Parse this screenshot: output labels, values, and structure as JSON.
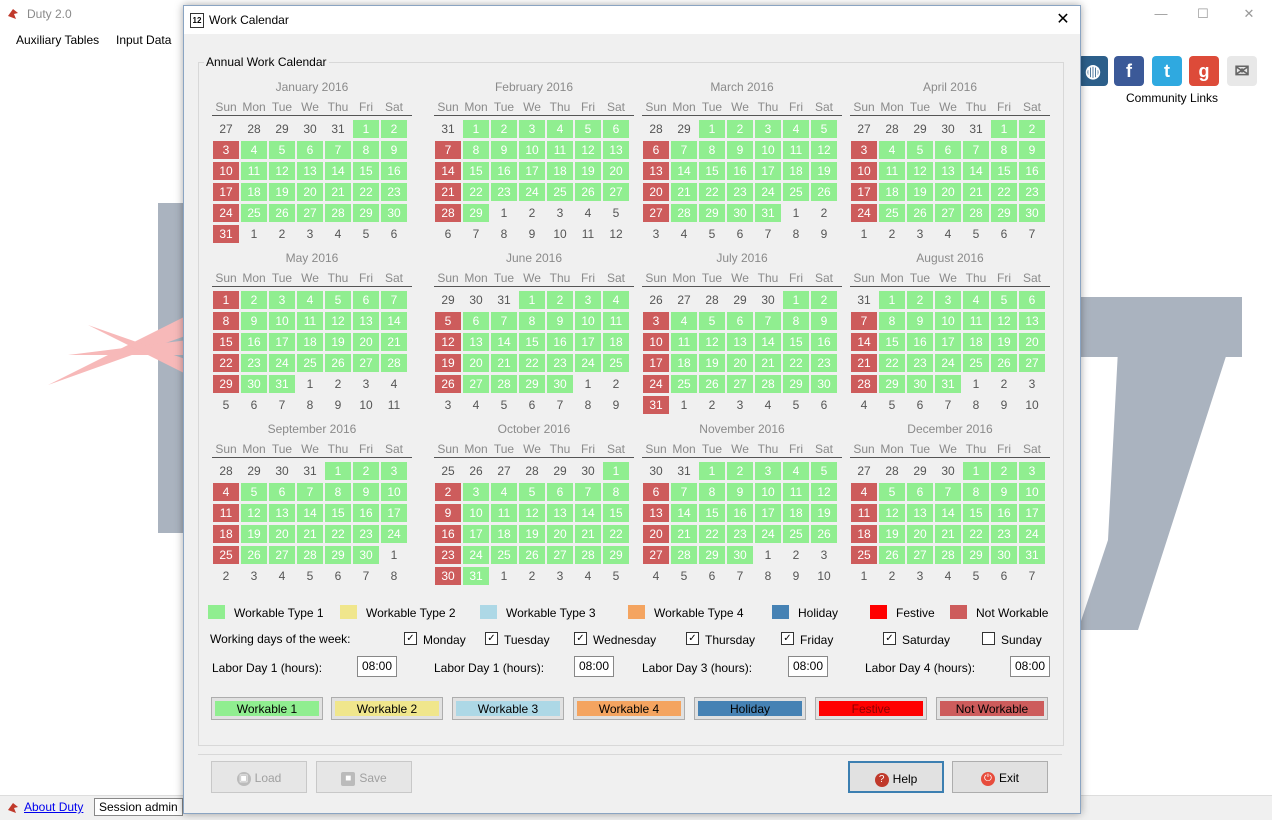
{
  "app": {
    "title": "Duty 2.0",
    "menu": [
      "Auxiliary Tables",
      "Input Data"
    ]
  },
  "status": {
    "about": "About Duty",
    "session": "Session admin"
  },
  "community": {
    "label": "Community Links",
    "icons": [
      "globe-icon",
      "facebook-icon",
      "twitter-icon",
      "google-icon",
      "mail-icon"
    ]
  },
  "dialog": {
    "title": "Work Calendar",
    "group_label": "Annual Work Calendar",
    "weekday_headers": [
      "Sun",
      "Mon",
      "Tue",
      "We",
      "Thu",
      "Fri",
      "Sat"
    ],
    "months": [
      {
        "name": "January 2016",
        "start": 5,
        "days": 31,
        "prev_days": 31
      },
      {
        "name": "February 2016",
        "start": 1,
        "days": 29,
        "prev_days": 31
      },
      {
        "name": "March 2016",
        "start": 2,
        "days": 31,
        "prev_days": 29
      },
      {
        "name": "April 2016",
        "start": 5,
        "days": 30,
        "prev_days": 31
      },
      {
        "name": "May 2016",
        "start": 0,
        "days": 31,
        "prev_days": 30
      },
      {
        "name": "June 2016",
        "start": 3,
        "days": 30,
        "prev_days": 31
      },
      {
        "name": "July 2016",
        "start": 5,
        "days": 31,
        "prev_days": 30
      },
      {
        "name": "August 2016",
        "start": 1,
        "days": 31,
        "prev_days": 31
      },
      {
        "name": "September 2016",
        "start": 4,
        "days": 30,
        "prev_days": 31
      },
      {
        "name": "October 2016",
        "start": 6,
        "days": 31,
        "prev_days": 30
      },
      {
        "name": "November 2016",
        "start": 2,
        "days": 30,
        "prev_days": 31
      },
      {
        "name": "December 2016",
        "start": 4,
        "days": 31,
        "prev_days": 30
      }
    ],
    "legend": [
      {
        "label": "Workable Type 1",
        "color": "#90ee90"
      },
      {
        "label": "Workable Type 2",
        "color": "#f0e68c"
      },
      {
        "label": "Workable Type 3",
        "color": "#add8e6"
      },
      {
        "label": "Workable Type 4",
        "color": "#f4a460"
      },
      {
        "label": "Holiday",
        "color": "#4682b4"
      },
      {
        "label": "Festive",
        "color": "#ff0000"
      },
      {
        "label": "Not Workable",
        "color": "#cd5c5c"
      }
    ],
    "working_days_label": "Working days of the week:",
    "days": [
      {
        "label": "Monday",
        "checked": true
      },
      {
        "label": "Tuesday",
        "checked": true
      },
      {
        "label": "Wednesday",
        "checked": true
      },
      {
        "label": "Thursday",
        "checked": true
      },
      {
        "label": "Friday",
        "checked": true
      },
      {
        "label": "Saturday",
        "checked": true
      },
      {
        "label": "Sunday",
        "checked": false
      }
    ],
    "labor": [
      {
        "label": "Labor Day 1 (hours):",
        "value": "08:00"
      },
      {
        "label": "Labor Day 1 (hours):",
        "value": "08:00"
      },
      {
        "label": "Labor Day 3 (hours):",
        "value": "08:00"
      },
      {
        "label": "Labor Day 4 (hours):",
        "value": "08:00"
      }
    ],
    "type_buttons": [
      {
        "label": "Workable 1",
        "color": "#90ee90",
        "text": "#000"
      },
      {
        "label": "Workable 2",
        "color": "#f0e68c",
        "text": "#000"
      },
      {
        "label": "Workable 3",
        "color": "#add8e6",
        "text": "#000"
      },
      {
        "label": "Workable 4",
        "color": "#f4a460",
        "text": "#000"
      },
      {
        "label": "Holiday",
        "color": "#4682b4",
        "text": "#000"
      },
      {
        "label": "Festive",
        "color": "#ff0000",
        "text": "#8b0000"
      },
      {
        "label": "Not Workable",
        "color": "#cd5c5c",
        "text": "#000"
      }
    ],
    "actions": {
      "load": "Load",
      "save": "Save",
      "help": "Help",
      "exit": "Exit"
    }
  }
}
